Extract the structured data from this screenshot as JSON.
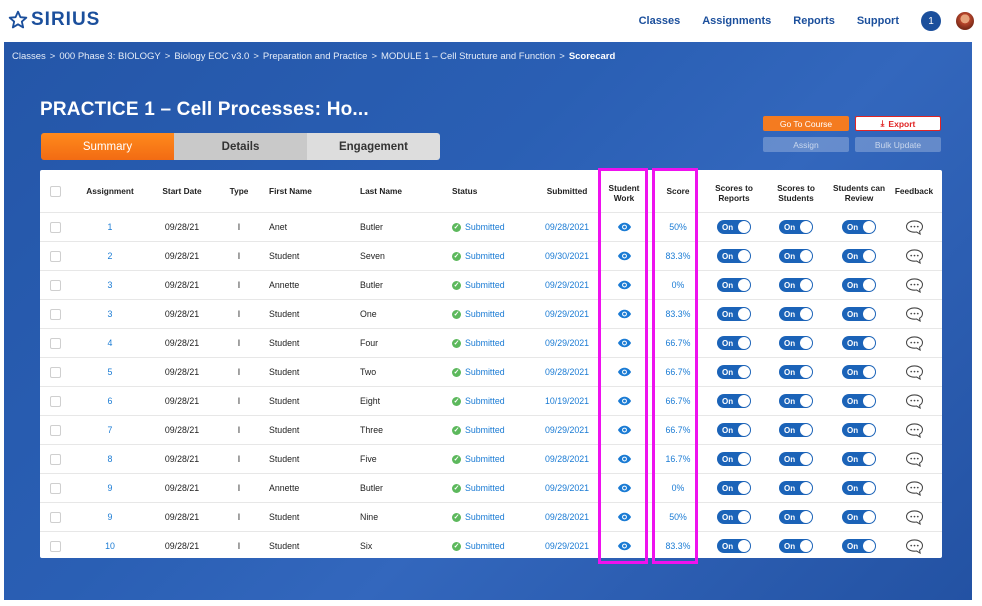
{
  "brand": {
    "name": "SIRIUS"
  },
  "nav": {
    "items": [
      "Classes",
      "Assignments",
      "Reports",
      "Support"
    ],
    "notifications": "1"
  },
  "breadcrumb": [
    "Classes",
    "000 Phase 3: BIOLOGY",
    "Biology EOC v3.0",
    "Preparation and Practice",
    "MODULE 1 – Cell Structure and Function",
    "Scorecard"
  ],
  "page": {
    "title": "PRACTICE 1 – Cell Processes: Ho..."
  },
  "tabs": [
    "Summary",
    "Details",
    "Engagement"
  ],
  "actions": {
    "go_to_course": "Go To Course",
    "export": "Export",
    "assign": "Assign",
    "bulk_update": "Bulk Update"
  },
  "columns": {
    "assignment": "Assignment",
    "start_date": "Start Date",
    "type": "Type",
    "first_name": "First Name",
    "last_name": "Last Name",
    "status": "Status",
    "submitted": "Submitted",
    "student_work": "Student Work",
    "score": "Score",
    "scores_to_reports": "Scores to Reports",
    "scores_to_students": "Scores to Students",
    "students_can_review": "Students can Review",
    "feedback": "Feedback"
  },
  "toggle_label": "On",
  "rows": [
    {
      "assignment": "1",
      "start_date": "09/28/21",
      "type": "I",
      "first_name": "Anet",
      "last_name": "Butler",
      "status": "Submitted",
      "submitted": "09/28/2021",
      "score": "50%"
    },
    {
      "assignment": "2",
      "start_date": "09/28/21",
      "type": "I",
      "first_name": "Student",
      "last_name": "Seven",
      "status": "Submitted",
      "submitted": "09/30/2021",
      "score": "83.3%"
    },
    {
      "assignment": "3",
      "start_date": "09/28/21",
      "type": "I",
      "first_name": "Annette",
      "last_name": "Butler",
      "status": "Submitted",
      "submitted": "09/29/2021",
      "score": "0%"
    },
    {
      "assignment": "3",
      "start_date": "09/28/21",
      "type": "I",
      "first_name": "Student",
      "last_name": "One",
      "status": "Submitted",
      "submitted": "09/29/2021",
      "score": "83.3%"
    },
    {
      "assignment": "4",
      "start_date": "09/28/21",
      "type": "I",
      "first_name": "Student",
      "last_name": "Four",
      "status": "Submitted",
      "submitted": "09/29/2021",
      "score": "66.7%"
    },
    {
      "assignment": "5",
      "start_date": "09/28/21",
      "type": "I",
      "first_name": "Student",
      "last_name": "Two",
      "status": "Submitted",
      "submitted": "09/28/2021",
      "score": "66.7%"
    },
    {
      "assignment": "6",
      "start_date": "09/28/21",
      "type": "I",
      "first_name": "Student",
      "last_name": "Eight",
      "status": "Submitted",
      "submitted": "10/19/2021",
      "score": "66.7%"
    },
    {
      "assignment": "7",
      "start_date": "09/28/21",
      "type": "I",
      "first_name": "Student",
      "last_name": "Three",
      "status": "Submitted",
      "submitted": "09/29/2021",
      "score": "66.7%"
    },
    {
      "assignment": "8",
      "start_date": "09/28/21",
      "type": "I",
      "first_name": "Student",
      "last_name": "Five",
      "status": "Submitted",
      "submitted": "09/28/2021",
      "score": "16.7%"
    },
    {
      "assignment": "9",
      "start_date": "09/28/21",
      "type": "I",
      "first_name": "Annette",
      "last_name": "Butler",
      "status": "Submitted",
      "submitted": "09/29/2021",
      "score": "0%"
    },
    {
      "assignment": "9",
      "start_date": "09/28/21",
      "type": "I",
      "first_name": "Student",
      "last_name": "Nine",
      "status": "Submitted",
      "submitted": "09/28/2021",
      "score": "50%"
    },
    {
      "assignment": "10",
      "start_date": "09/28/21",
      "type": "I",
      "first_name": "Student",
      "last_name": "Six",
      "status": "Submitted",
      "submitted": "09/29/2021",
      "score": "83.3%"
    }
  ],
  "colors": {
    "brand_blue": "#1b4f9c",
    "accent_orange": "#f47b20",
    "highlight_magenta": "#ee11ee",
    "link_blue": "#1a7bd4"
  }
}
